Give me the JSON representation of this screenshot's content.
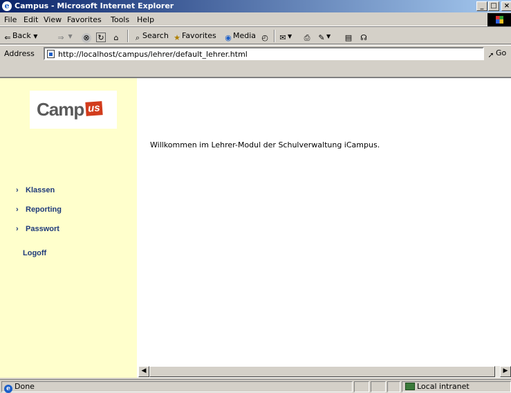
{
  "window": {
    "title": "Campus - Microsoft Internet Explorer",
    "buttons": {
      "minimize": "_",
      "maximize": "□",
      "close": "×"
    }
  },
  "menu": [
    "File",
    "Edit",
    "View",
    "Favorites",
    "Tools",
    "Help"
  ],
  "toolbar": {
    "back": "Back",
    "search": "Search",
    "favorites": "Favorites",
    "media": "Media"
  },
  "address": {
    "label": "Address",
    "url": "http://localhost/campus/lehrer/default_lehrer.html",
    "go": "Go"
  },
  "page": {
    "logo_text": "Camp",
    "logo_badge": "us",
    "nav": [
      "Klassen",
      "Reporting",
      "Passwort"
    ],
    "logoff": "Logoff",
    "welcome": "Willkommen im Lehrer-Modul der Schulverwaltung iCampus."
  },
  "status": {
    "text": "Done",
    "zone": "Local intranet"
  },
  "colors": {
    "sidebar_bg": "#ffffcc",
    "nav_link": "#1f3a7a",
    "logo_badge": "#d23c1c",
    "title_bar": "#0a246a"
  }
}
